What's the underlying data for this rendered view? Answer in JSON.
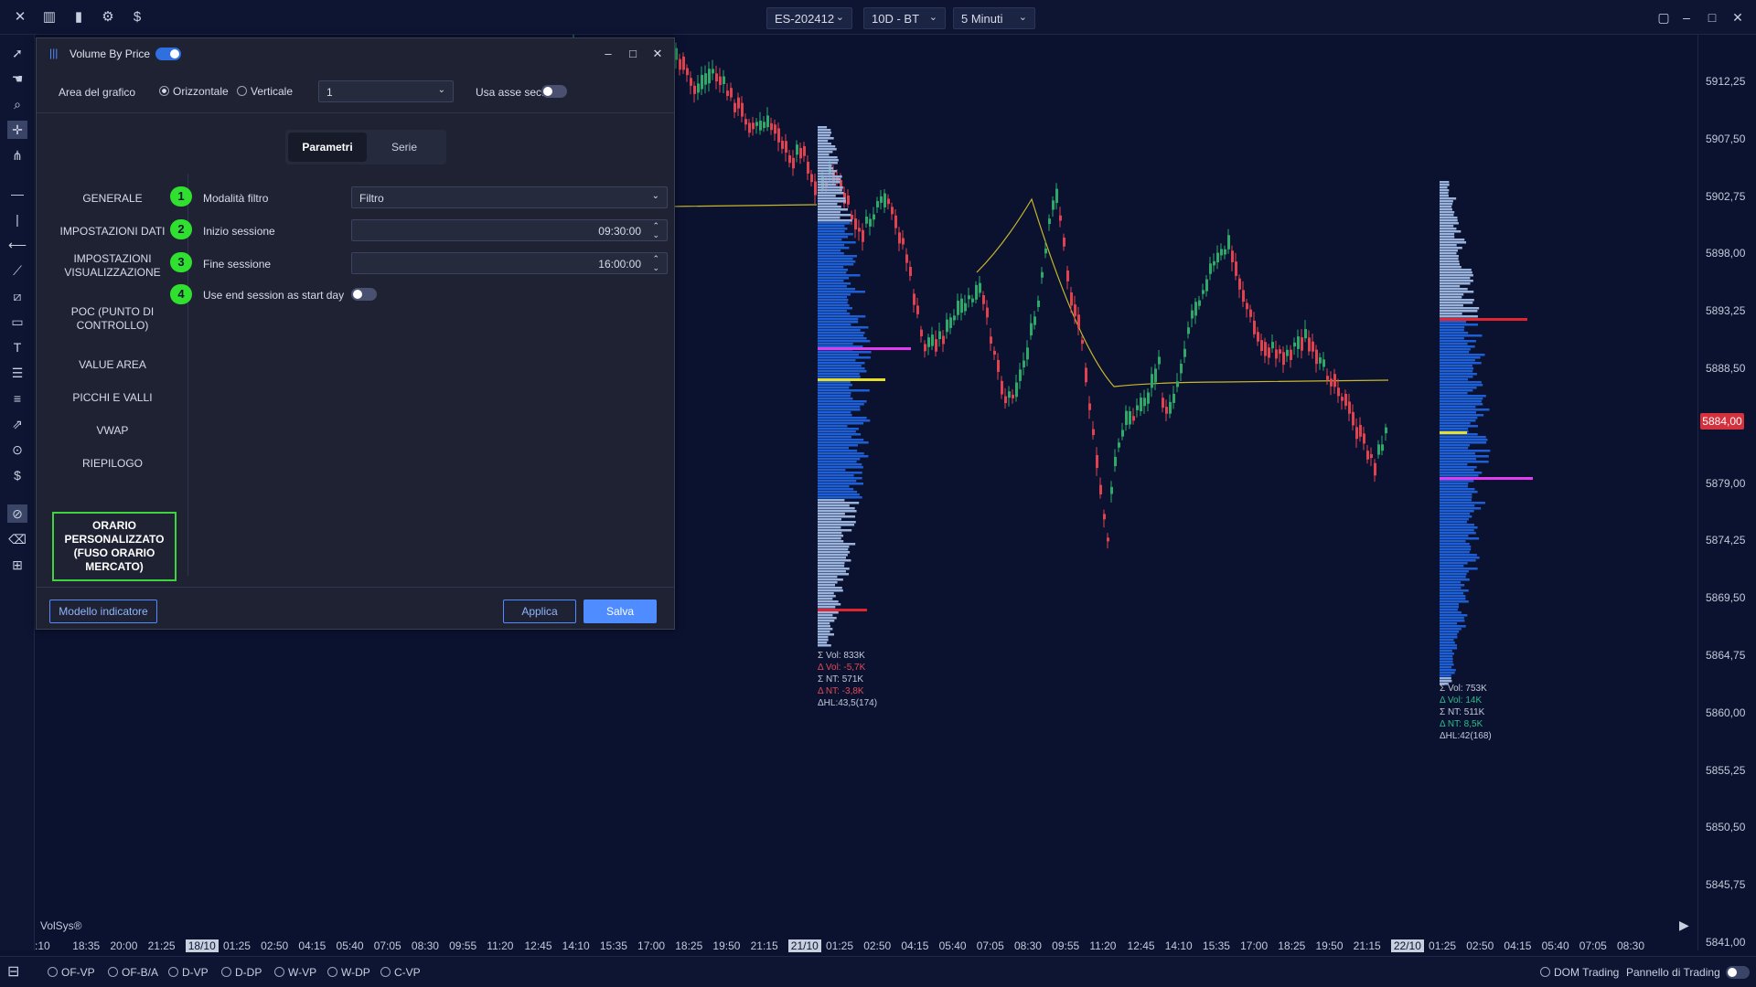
{
  "topbar": {
    "symbol": "ES-202412",
    "timeframe": "10D - BT",
    "interval": "5 Minuti",
    "icons": [
      "close-icon",
      "candles-icon",
      "bar-chart-icon",
      "settings-icon",
      "dollar-icon"
    ]
  },
  "price_axis": {
    "labels": [
      "5912,25",
      "5907,50",
      "5902,75",
      "5898,00",
      "5893,25",
      "5888,50",
      "5884,00",
      "5879,00",
      "5874,25",
      "5869,50",
      "5864,75",
      "5860,00",
      "5855,25",
      "5850,50",
      "5845,75",
      "5841,00"
    ],
    "current_price": "5884,00"
  },
  "time_axis": {
    "labels": [
      ":10",
      "18:35",
      "20:00",
      "21:25",
      "18/10",
      "01:25",
      "02:50",
      "04:15",
      "05:40",
      "07:05",
      "08:30",
      "09:55",
      "11:20",
      "12:45",
      "14:10",
      "15:35",
      "17:00",
      "18:25",
      "19:50",
      "21:15",
      "21/10",
      "01:25",
      "02:50",
      "04:15",
      "05:40",
      "07:05",
      "08:30",
      "09:55",
      "11:20",
      "12:45",
      "14:10",
      "15:35",
      "17:00",
      "18:25",
      "19:50",
      "21:15",
      "22/10",
      "01:25",
      "02:50",
      "04:15",
      "05:40",
      "07:05",
      "08:30"
    ]
  },
  "chart_brand": "VolSys®",
  "profile1_stats": {
    "vol": "Σ Vol: 833K",
    "dvol": "Δ Vol: -5,7K",
    "nt": "Σ NT: 571K",
    "dnt": "Δ NT: -3,8K",
    "hl": "ΔHL:43,5(174)"
  },
  "profile2_stats": {
    "vol": "Σ Vol: 753K",
    "dvol": "Δ Vol: 14K",
    "nt": "Σ NT: 511K",
    "dnt": "Δ NT: 8,5K",
    "hl": "ΔHL:42(168)"
  },
  "bottom_bar": {
    "options": [
      "OF-VP",
      "OF-B/A",
      "D-VP",
      "D-DP",
      "W-VP",
      "W-DP",
      "C-VP"
    ],
    "dom_trading": "DOM Trading",
    "trading_panel": "Pannello di Trading"
  },
  "dialog": {
    "title": "Volume By Price",
    "chart_area_label": "Area del grafico",
    "horizontal": "Orizzontale",
    "vertical": "Verticale",
    "chart_area_value": "1",
    "secondary_axis": "Usa asse sec.",
    "tabs": [
      "Parametri",
      "Serie"
    ],
    "nav": [
      "GENERALE",
      "IMPOSTAZIONI DATI",
      "IMPOSTAZIONI VISUALIZZAZIONE",
      "POC (PUNTO DI CONTROLLO)",
      "VALUE AREA",
      "PICCHI E VALLI",
      "VWAP",
      "RIEPILOGO",
      "ORARIO PERSONALIZZATO (FUSO ORARIO MERCATO)"
    ],
    "fields": [
      {
        "num": "1",
        "label": "Modalità filtro",
        "value": "Filtro"
      },
      {
        "num": "2",
        "label": "Inizio sessione",
        "value": "09:30:00"
      },
      {
        "num": "3",
        "label": "Fine sessione",
        "value": "16:00:00"
      },
      {
        "num": "4",
        "label": "Use end session as start day",
        "value": ""
      }
    ],
    "template_btn": "Modello indicatore",
    "apply_btn": "Applica",
    "save_btn": "Salva"
  }
}
